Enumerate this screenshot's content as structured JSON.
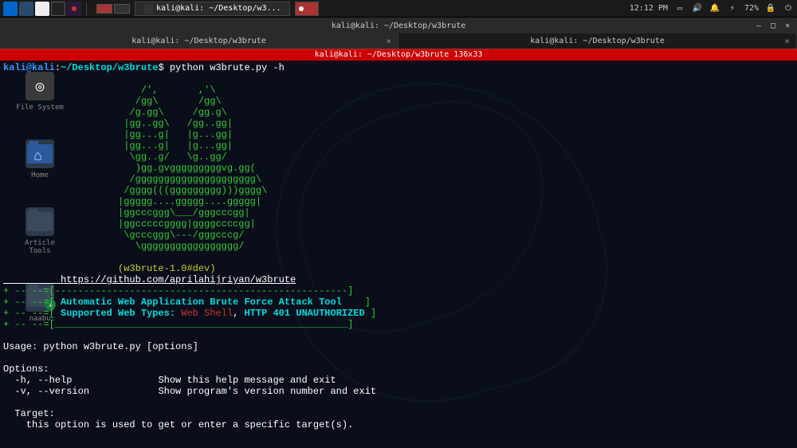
{
  "taskbar": {
    "time": "12:12 PM",
    "battery": "72%",
    "task_label": "kali@kali: ~/Desktop/w3..."
  },
  "desktop_icons": [
    {
      "label": "File System",
      "type": "system"
    },
    {
      "label": "Home",
      "type": "home"
    },
    {
      "label": "Article Tools",
      "type": "folder"
    },
    {
      "label": "naabu",
      "type": "folder-badge"
    }
  ],
  "window": {
    "title": "kali@kali: ~/Desktop/w3brute",
    "tabs": [
      {
        "label": "kali@kali: ~/Desktop/w3brute",
        "active": true
      },
      {
        "label": "kali@kali: ~/Desktop/w3brute",
        "active": false
      }
    ],
    "red_bar": "kali@kali: ~/Desktop/w3brute 136x33"
  },
  "terminal": {
    "prompt_user": "kali@kali",
    "prompt_sep": ":",
    "prompt_path": "~/Desktop/w3brute",
    "prompt_dollar": "$",
    "command": " python w3brute.py -h",
    "ascii_art": "                        /',       ,'\\\n                       /gg\\       /gg\\\n                      /g.gg\\     /gg.g\\\n                     |gg..gg\\   /gg..gg|\n                     |gg...g|   |g...gg|\n                     |gg...g|   |g...gg|\n                      \\gg..g/   \\g..gg/\n                       )gg.gvgggggggggvg.gg(\n                      /ggggggggggggggggggggg\\\n                     /gggg(((ggggggggg)))gggg\\\n                    |ggggg....ggggg....ggggg|\n                    |ggcccggg\\___/gggcccgg|\n                    |ggcccccgggg|ggggccccgg|\n                     \\gcccggg\\---/gggcccg/\n                       \\ggggggggggggggggg/\n",
    "version_line": "                    (w3brute-1.0#dev)",
    "github_url": "          https://github.com/aprilahijriyan/w3brute",
    "box_top": "+ -- --=[---------------------------------------------------]",
    "box_line1_prefix": "+ -- --=[ ",
    "box_line1_text": "Automatic Web Application Brute Force Attack Tool",
    "box_line1_suffix": "    ]",
    "box_line2_prefix": "+ -- --=[ ",
    "box_line2_text1": "Supported Web Types: ",
    "box_line2_red": "Web Shell",
    "box_line2_sep": ", ",
    "box_line2_cyan": "HTTP 401 UNAUTHORIZED",
    "box_line2_suffix": " ]",
    "box_bottom": "+ -- --=[___________________________________________________]",
    "usage": "Usage: python w3brute.py [options]",
    "options_header": "Options:",
    "opt1_flag": "  -h, --help",
    "opt1_desc": "               Show this help message and exit",
    "opt2_flag": "  -v, --version",
    "opt2_desc": "            Show program's version number and exit",
    "target_header": "  Target:",
    "target_desc": "    this option is used to get or enter a specific target(s)."
  }
}
